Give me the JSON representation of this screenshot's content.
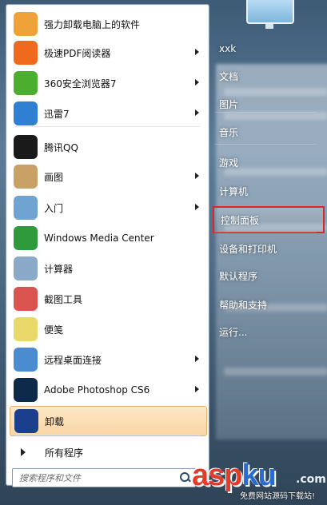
{
  "programs": [
    {
      "label": "强力卸载电脑上的软件",
      "icon": "uninstall-box-icon",
      "color": "#f0a23a",
      "submenu": false
    },
    {
      "label": "极速PDF阅读器",
      "icon": "pdf-reader-icon",
      "color": "#ef6a1c",
      "submenu": true
    },
    {
      "label": "360安全浏览器7",
      "icon": "360-browser-icon",
      "color": "#4cae2f",
      "submenu": true
    },
    {
      "label": "迅雷7",
      "icon": "thunder-bird-icon",
      "color": "#2f7fd3",
      "submenu": true
    },
    {
      "label": "腾讯QQ",
      "icon": "qq-penguin-icon",
      "color": "#1a1a1a",
      "submenu": false
    },
    {
      "label": "画图",
      "icon": "paint-palette-icon",
      "color": "#c9a066",
      "submenu": true
    },
    {
      "label": "入门",
      "icon": "getting-started-icon",
      "color": "#6fa3d2",
      "submenu": true
    },
    {
      "label": "Windows Media Center",
      "icon": "windows-media-center-icon",
      "color": "#2f9a3c",
      "submenu": false
    },
    {
      "label": "计算器",
      "icon": "calculator-icon",
      "color": "#8aa9c8",
      "submenu": false
    },
    {
      "label": "截图工具",
      "icon": "snipping-tool-icon",
      "color": "#d9534f",
      "submenu": false
    },
    {
      "label": "便笺",
      "icon": "sticky-notes-icon",
      "color": "#e9d86a",
      "submenu": false
    },
    {
      "label": "远程桌面连接",
      "icon": "remote-desktop-icon",
      "color": "#4a8ccf",
      "submenu": true
    },
    {
      "label": "Adobe Photoshop CS6",
      "icon": "photoshop-icon",
      "color": "#0d2a4a",
      "submenu": true
    },
    {
      "label": "卸载",
      "icon": "hp-logo-icon",
      "color": "#1b3f8c",
      "submenu": false,
      "selected": true
    }
  ],
  "all_programs": "所有程序",
  "search": {
    "placeholder": "搜索程序和文件"
  },
  "right_menu": [
    {
      "label": "xxk"
    },
    {
      "label": "文档"
    },
    {
      "label": "图片"
    },
    {
      "label": "音乐"
    },
    {
      "label": "游戏"
    },
    {
      "label": "计算机"
    },
    {
      "label": "控制面板",
      "highlight": true
    },
    {
      "label": "设备和打印机"
    },
    {
      "label": "默认程序"
    },
    {
      "label": "帮助和支持"
    },
    {
      "label": "运行..."
    }
  ],
  "watermark": {
    "asp": "asp",
    "ku": "ku",
    "net": ".com",
    "sub": "免费网站源码下载站!"
  }
}
